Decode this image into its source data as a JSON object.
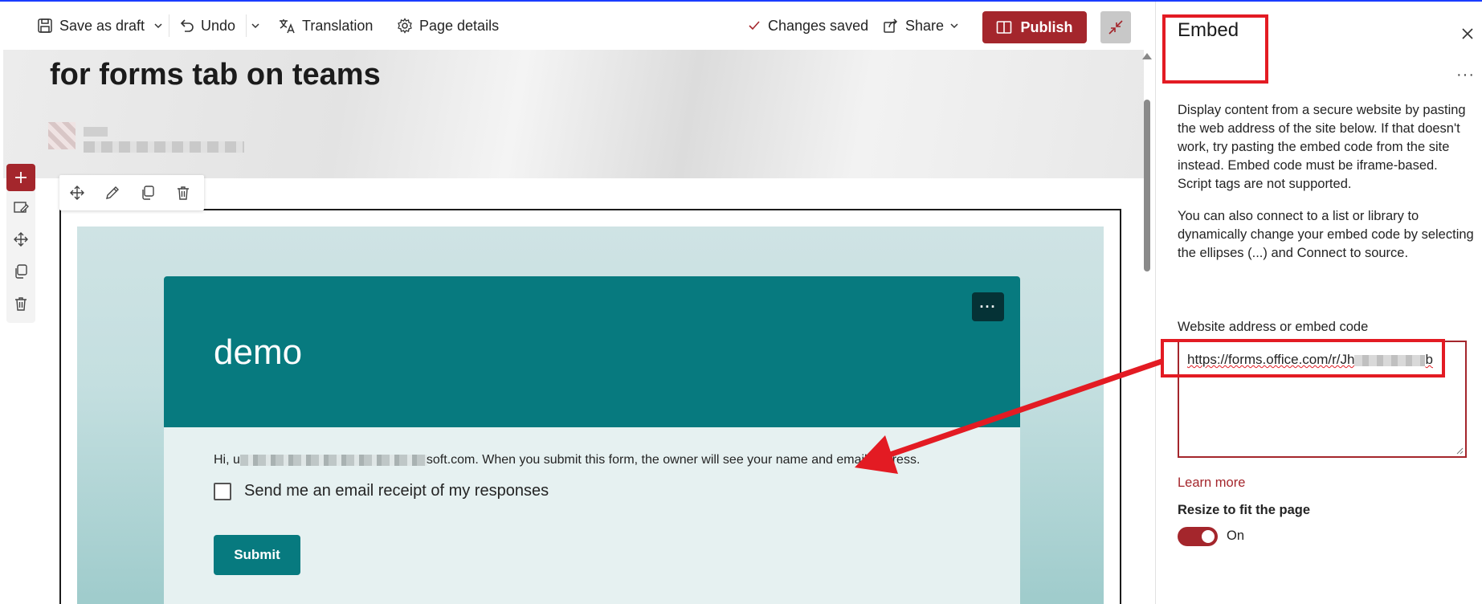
{
  "toolbar": {
    "save_draft": "Save as draft",
    "undo": "Undo",
    "translation": "Translation",
    "page_details": "Page details",
    "status": "Changes saved",
    "share": "Share",
    "publish": "Publish"
  },
  "page": {
    "title": "for forms tab on teams"
  },
  "form": {
    "title": "demo",
    "notice_prefix": "Hi, u",
    "notice_suffix": "soft.com. When you submit this form, the owner will see your name and email address.",
    "checkbox_label": "Send me an email receipt of my responses",
    "submit": "Submit",
    "more": "···"
  },
  "pane": {
    "title": "Embed",
    "more": "···",
    "description": "Display content from a secure website by pasting the web address of the site below. If that doesn't work, try pasting the embed code from the site instead. Embed code must be iframe-based. Script tags are not supported.",
    "description2": "You can also connect to a list or library to dynamically change your embed code by selecting the ellipses (...) and Connect to source.",
    "field_label": "Website address or embed code",
    "embed_value_prefix": "https://forms.office.com/r/Jh",
    "embed_value_suffix": "b",
    "learn_more": "Learn more",
    "resize_label": "Resize to fit the page",
    "toggle_state": "On"
  },
  "colors": {
    "brand": "#a4262c",
    "form_teal": "#077a7f",
    "annotation_red": "#e31b23"
  }
}
